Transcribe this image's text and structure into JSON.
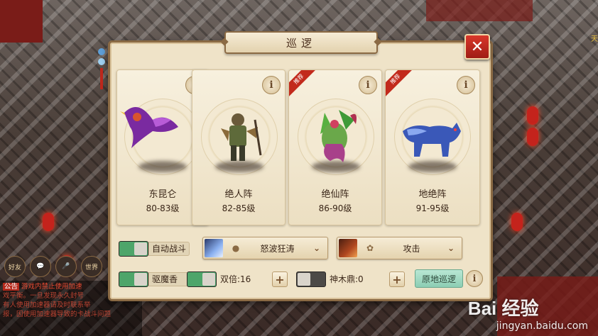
{
  "dialog": {
    "title": "巡逻",
    "close_label": "✕"
  },
  "cards": [
    {
      "name": "东昆仑",
      "level": "80-83级",
      "recommended": false,
      "creature": "purple-bird"
    },
    {
      "name": "绝人阵",
      "level": "82-85级",
      "recommended": false,
      "creature": "armored-warrior"
    },
    {
      "name": "绝仙阵",
      "level": "86-90级",
      "recommended": true,
      "creature": "mantis-beast"
    },
    {
      "name": "地绝阵",
      "level": "91-95级",
      "recommended": true,
      "creature": "blue-wolf"
    }
  ],
  "ribbon_label": "推荐",
  "info_glyph": "i",
  "controls": {
    "auto_battle": {
      "label": "自动战斗",
      "on": true
    },
    "skill_select": {
      "value": "怒波狂涛"
    },
    "action_select": {
      "value": "攻击"
    },
    "demon_incense": {
      "label": "驱魔香",
      "on": true
    },
    "double": {
      "label": "双倍:16",
      "on": true
    },
    "shenmu": {
      "label": "神木鼎:0",
      "on": false
    },
    "plus_glyph": "+",
    "go_button": "原地巡逻",
    "help_glyph": "i"
  },
  "chat": {
    "buttons": [
      "好友",
      "💬",
      "🎤",
      "世界"
    ],
    "tag": "公告",
    "lines": [
      "游戏内禁止使用加速",
      "戏平衡。一旦发现永久封号",
      "有人使用加速器请及时联系举",
      "报，因使用加速器导致的卡战斗问题"
    ]
  },
  "hud": {
    "top_right": "天"
  },
  "watermark": {
    "brand": "Bai 经验",
    "url": "jingyan.baidu.com"
  },
  "colors": {
    "accent_red": "#c22a1c",
    "toggle_green": "#4ea56a",
    "panel_bg": "#efe3c8",
    "go_button": "#9fd9c1"
  }
}
